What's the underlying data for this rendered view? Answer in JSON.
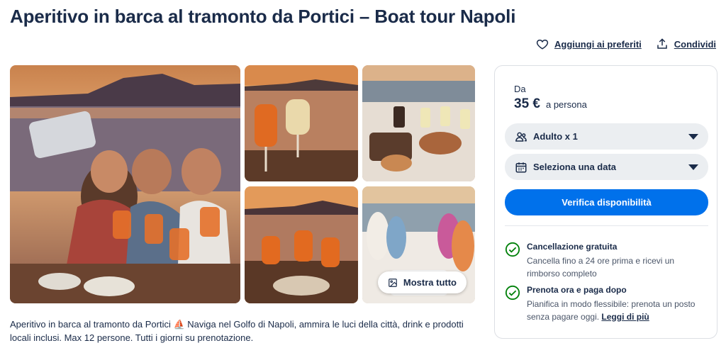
{
  "page": {
    "title": "Aperitivo in barca al tramonto da Portici – Boat tour Napoli"
  },
  "actions": {
    "favorites_label": "Aggiungi ai preferiti",
    "share_label": "Condividi"
  },
  "gallery": {
    "show_all_label": "Mostra tutto",
    "images": [
      "selfie-group-toast",
      "spritz-glasses-sunset",
      "boat-table-food",
      "cheers-drinks-sunset",
      "friends-on-boat-deck"
    ]
  },
  "description": "Aperitivo in barca al tramonto da Portici ⛵ Naviga nel Golfo di Napoli, ammira le luci della città, drink e prodotti locali inclusi. Max 12 persone. Tutti i giorni su prenotazione.",
  "booking": {
    "from_label": "Da",
    "price": "35 €",
    "price_unit": "a persona",
    "participants_label": "Adulto x 1",
    "date_label": "Seleziona una data",
    "cta_label": "Verifica disponibilità",
    "benefits": [
      {
        "title": "Cancellazione gratuita",
        "text": "Cancella fino a 24 ore prima e ricevi un rimborso completo"
      },
      {
        "title": "Prenota ora e paga dopo",
        "text": "Pianifica in modo flessibile: prenota un posto senza pagare oggi.",
        "link": "Leggi di più"
      }
    ]
  },
  "colors": {
    "primary": "#0071eb",
    "text": "#1a2b49",
    "check": "#008009"
  }
}
